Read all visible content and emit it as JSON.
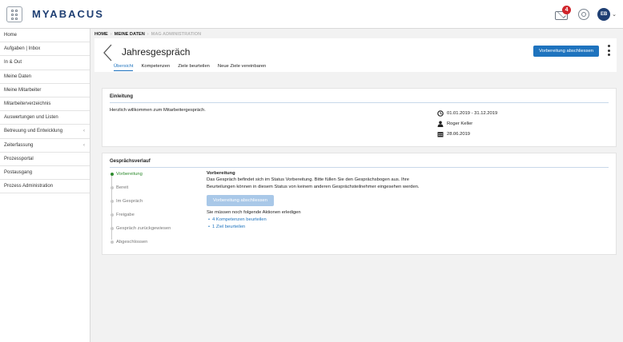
{
  "app": {
    "logo": "MYABACUS"
  },
  "topbar": {
    "notification_count": "4",
    "avatar_initials": "EB",
    "colors": {
      "brand": "#1f3f73",
      "badge": "#d0252c"
    }
  },
  "sidebar": {
    "items": [
      {
        "label": "Home",
        "has_arrow": false
      },
      {
        "label": "Aufgaben | Inbox",
        "has_arrow": false
      },
      {
        "label": "In & Out",
        "has_arrow": false
      },
      {
        "label": "Meine Daten",
        "has_arrow": false
      },
      {
        "label": "Meine Mitarbeiter",
        "has_arrow": false
      },
      {
        "label": "Mitarbeiterverzeichnis",
        "has_arrow": false
      },
      {
        "label": "Auswertungen und Listen",
        "has_arrow": false
      },
      {
        "label": "Betreuung und Entwicklung",
        "has_arrow": true
      },
      {
        "label": "Zeiterfassung",
        "has_arrow": true
      },
      {
        "label": "Prozessportal",
        "has_arrow": false
      },
      {
        "label": "Postausgang",
        "has_arrow": false
      },
      {
        "label": "Prozess Administration",
        "has_arrow": false
      }
    ]
  },
  "breadcrumb": {
    "home": "HOME",
    "current": "MEINE DATEN",
    "inactive": "MAG ADMINISTRATION"
  },
  "header": {
    "title": "Jahresgespräch",
    "primary_button": "Vorbereitung abschliessen",
    "tabs": [
      {
        "label": "Übersicht",
        "active": true
      },
      {
        "label": "Kompetenzen",
        "active": false
      },
      {
        "label": "Ziele beurteilen",
        "active": false
      },
      {
        "label": "Neue Ziele vereinbaren",
        "active": false
      }
    ]
  },
  "intro": {
    "title": "Einleitung",
    "welcome": "Herzlich willkommen zum Mitarbeitergespräch.",
    "period": "01.01.2019 - 31.12.2019",
    "person": "Roger Keller",
    "date": "28.06.2019"
  },
  "history": {
    "title": "Gesprächsverlauf",
    "steps": [
      {
        "label": "Vorbereitung",
        "active": true
      },
      {
        "label": "Bereit",
        "active": false
      },
      {
        "label": "Im Gespräch",
        "active": false
      },
      {
        "label": "Freigabe",
        "active": false
      },
      {
        "label": "Gespräch zurückgewiesen",
        "active": false
      },
      {
        "label": "Abgeschlossen",
        "active": false
      }
    ],
    "detail_title": "Vorbereitung",
    "detail_line1": "Das Gespräch befindet sich im Status Vorbereitung. Bitte füllen Sie den Gesprächsbogen aus. Ihre",
    "detail_line2": "Beurteilungen können in diesem Status von keinem anderen Gesprächsteilnehmer eingesehen werden.",
    "detail_button": "Vorbereitung abschliessen",
    "actions_intro": "Sie müssen noch folgende Aktionen erledigen",
    "actions": [
      "4 Kompetenzen beurteilen",
      "1 Ziel beurteilen"
    ],
    "colors": {
      "active_step": "#2e8b2e",
      "link": "#1e73be"
    }
  }
}
